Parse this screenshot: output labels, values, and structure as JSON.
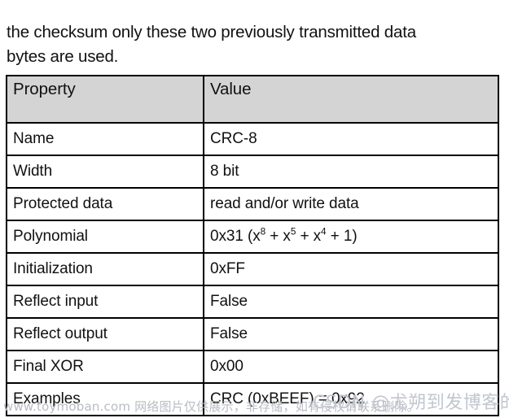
{
  "intro": {
    "paragraph": "the checksum only these two previously transmitted data\nbytes are used."
  },
  "table": {
    "headers": {
      "property": "Property",
      "value": "Value"
    },
    "rows": [
      {
        "property": "Name",
        "value": "CRC-8"
      },
      {
        "property": "Width",
        "value": "8 bit"
      },
      {
        "property": "Protected data",
        "value": "read and/or write data"
      },
      {
        "property": "Polynomial",
        "value": "0x31 (x8 + x5 + x4 + 1)",
        "value_parts": [
          {
            "t": "0x31 (x"
          },
          {
            "t": "8",
            "sup": true
          },
          {
            "t": " + x"
          },
          {
            "t": "5",
            "sup": true
          },
          {
            "t": " + x"
          },
          {
            "t": "4",
            "sup": true
          },
          {
            "t": " + 1)"
          }
        ]
      },
      {
        "property": "Initialization",
        "value": "0xFF"
      },
      {
        "property": "Reflect input",
        "value": "False"
      },
      {
        "property": "Reflect output",
        "value": "False"
      },
      {
        "property": "Final XOR",
        "value": "0x00"
      },
      {
        "property": "Examples",
        "value": "CRC (0xBEEF) = 0x92"
      }
    ]
  },
  "watermarks": {
    "left": "www.toymoban.com 网络图片仅供展示，非存储，如有侵权请联系删除。",
    "right": "CSDN @尤朔到发博客的菜鸟"
  },
  "colors": {
    "header_fill": "#d4d4d4",
    "border": "#000000",
    "text": "#111111",
    "watermark": "#c2c6cf",
    "background": "#ffffff"
  }
}
